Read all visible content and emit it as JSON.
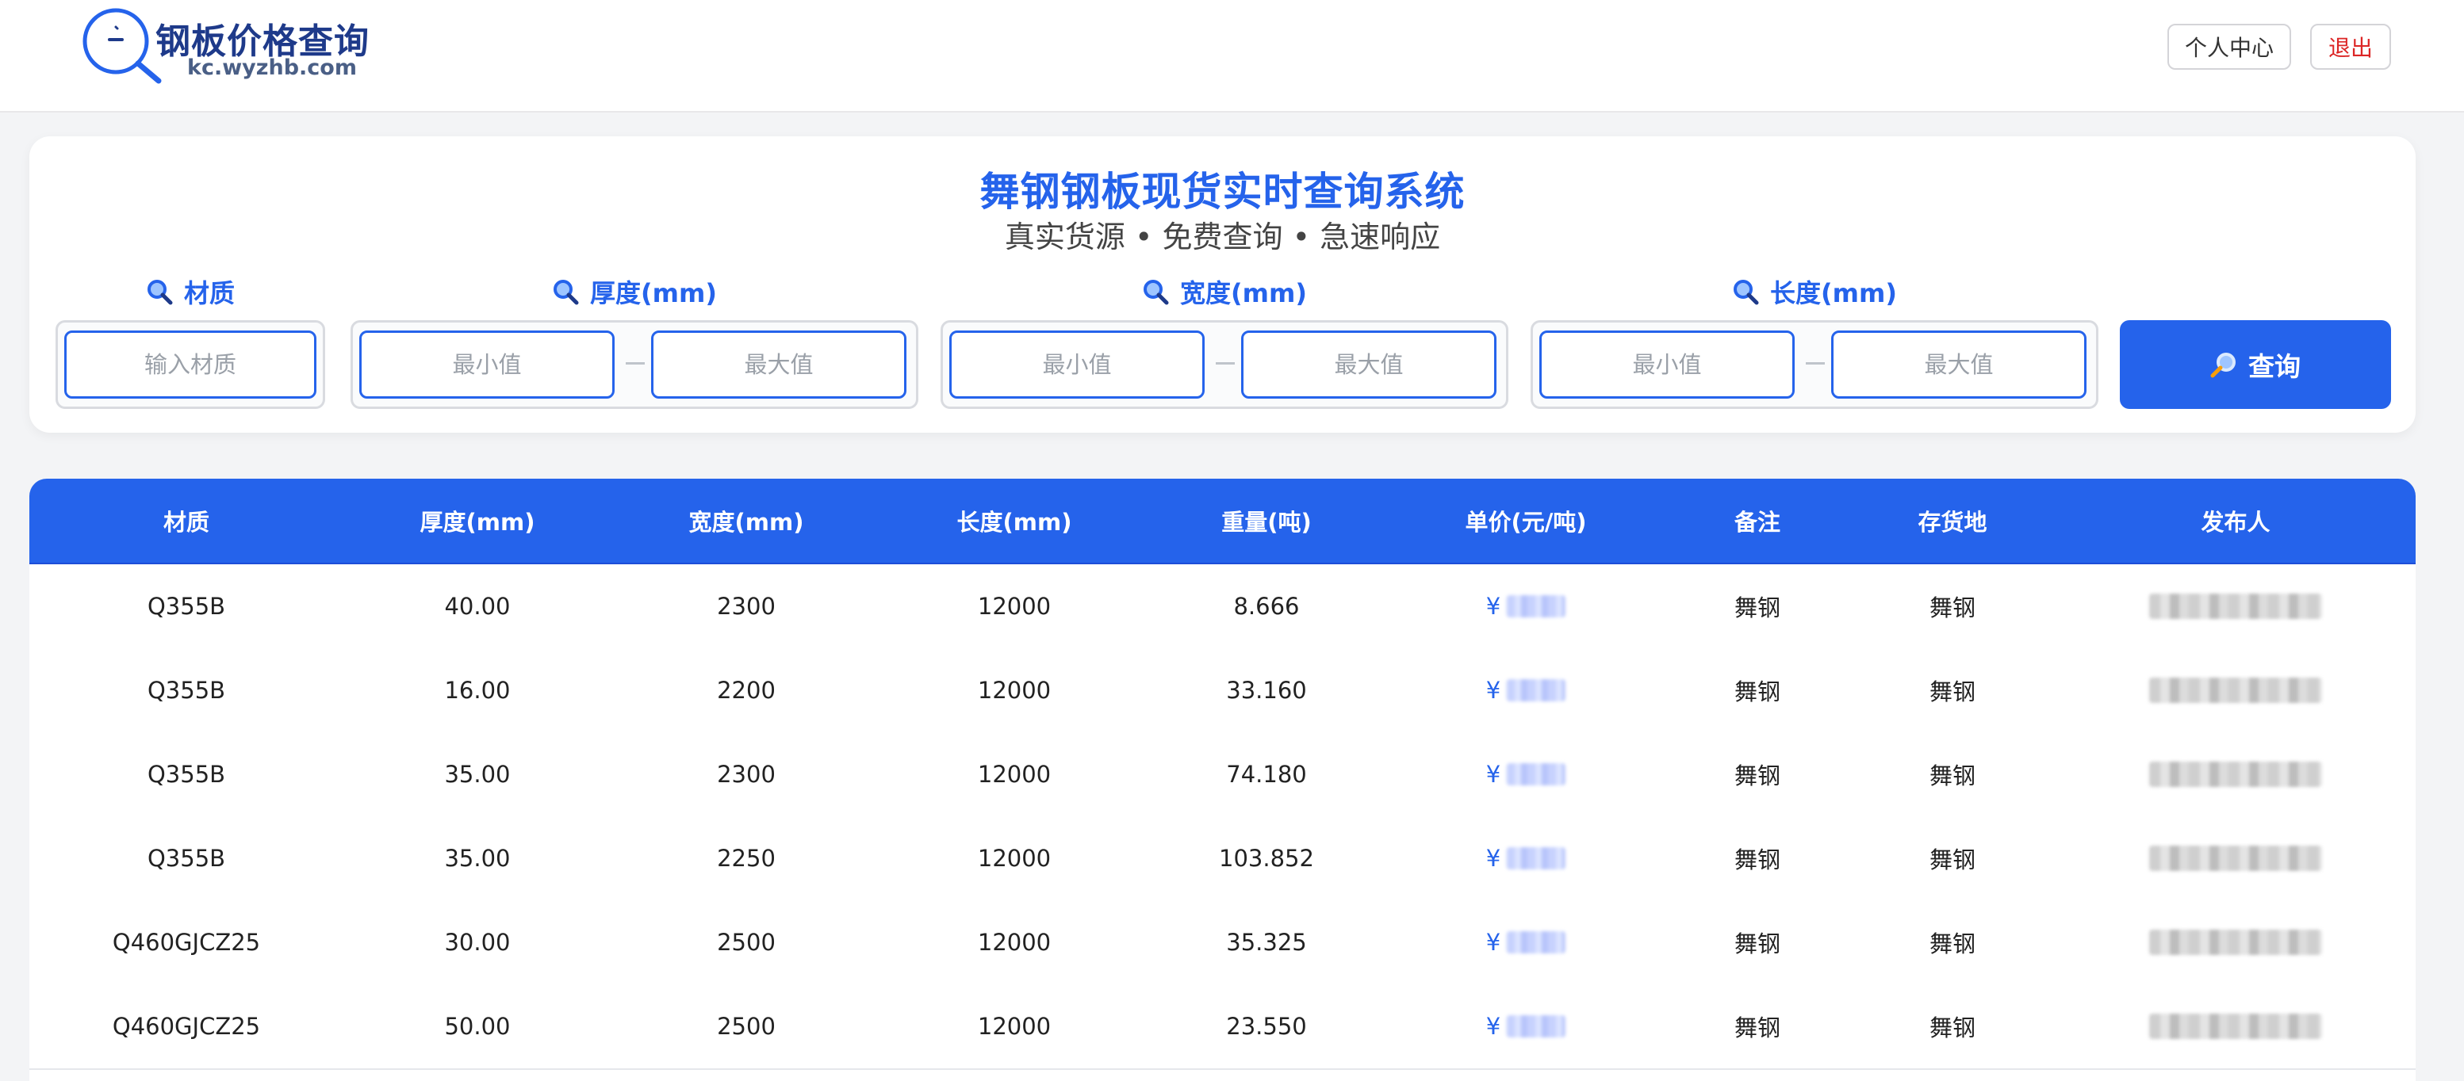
{
  "header": {
    "logo_title": "钢板价格查询",
    "logo_domain": "kc.wyzhb.com",
    "personal_center": "个人中心",
    "logout": "退出"
  },
  "search": {
    "title": "舞钢钢板现货实时查询系统",
    "subtitle": "真实货源 • 免费查询 • 急速响应",
    "material_label": "材质",
    "material_placeholder": "输入材质",
    "thickness_label": "厚度(mm)",
    "width_label": "宽度(mm)",
    "length_label": "长度(mm)",
    "min_placeholder": "最小值",
    "max_placeholder": "最大值",
    "query_label": "查询"
  },
  "table": {
    "headers": [
      "材质",
      "厚度(mm)",
      "宽度(mm)",
      "长度(mm)",
      "重量(吨)",
      "单价(元/吨)",
      "备注",
      "存货地",
      "发布人"
    ],
    "currency": "¥",
    "rows": [
      {
        "material": "Q355B",
        "thickness": "40.00",
        "width": "2300",
        "length": "12000",
        "weight": "8.666",
        "remark": "舞钢",
        "location": "舞钢"
      },
      {
        "material": "Q355B",
        "thickness": "16.00",
        "width": "2200",
        "length": "12000",
        "weight": "33.160",
        "remark": "舞钢",
        "location": "舞钢"
      },
      {
        "material": "Q355B",
        "thickness": "35.00",
        "width": "2300",
        "length": "12000",
        "weight": "74.180",
        "remark": "舞钢",
        "location": "舞钢"
      },
      {
        "material": "Q355B",
        "thickness": "35.00",
        "width": "2250",
        "length": "12000",
        "weight": "103.852",
        "remark": "舞钢",
        "location": "舞钢"
      },
      {
        "material": "Q460GJCZ25",
        "thickness": "30.00",
        "width": "2500",
        "length": "12000",
        "weight": "35.325",
        "remark": "舞钢",
        "location": "舞钢"
      },
      {
        "material": "Q460GJCZ25",
        "thickness": "50.00",
        "width": "2500",
        "length": "12000",
        "weight": "23.550",
        "remark": "舞钢",
        "location": "舞钢"
      }
    ]
  },
  "colors": {
    "accent": "#2563eb",
    "logo_text": "#1e3a8a",
    "logout": "#dc2626",
    "background": "#f3f4f6"
  },
  "icons": {
    "logo": "magnifier-logo-icon",
    "field": "magnifying-glass-icon",
    "query": "magnifying-glass-icon"
  }
}
